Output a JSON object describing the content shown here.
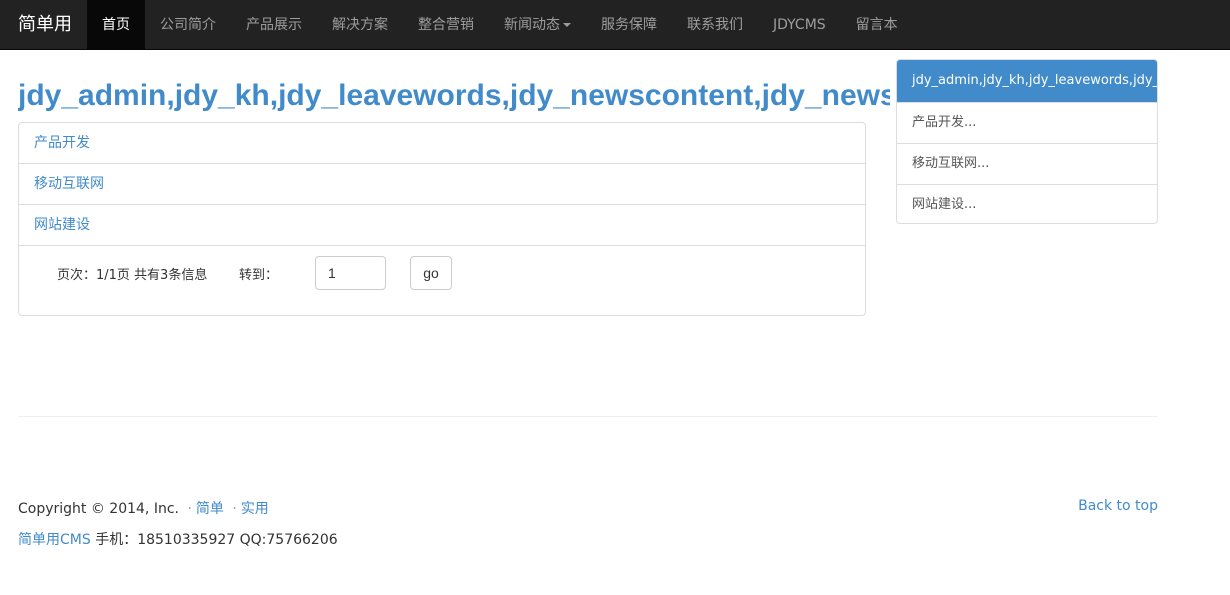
{
  "navbar": {
    "brand": "简单用",
    "items": [
      {
        "label": "首页",
        "active": true
      },
      {
        "label": "公司简介"
      },
      {
        "label": "产品展示"
      },
      {
        "label": "解决方案"
      },
      {
        "label": "整合营销"
      },
      {
        "label": "新闻动态",
        "dropdown": true
      },
      {
        "label": "服务保障"
      },
      {
        "label": "联系我们"
      },
      {
        "label": "JDYCMS"
      },
      {
        "label": "留言本"
      }
    ]
  },
  "main": {
    "heading": "jdy_admin,jdy_kh,jdy_leavewords,jdy_newscontent,jdy_newstype,jdy_pro",
    "list": [
      {
        "label": "产品开发"
      },
      {
        "label": "移动互联网"
      },
      {
        "label": "网站建设"
      }
    ],
    "pager": {
      "info": "页次：1/1页 共有3条信息",
      "goto_label": "转到：",
      "page_value": "1",
      "go_label": "go"
    }
  },
  "sidebar": {
    "active": "jdy_admin,jdy_kh,jdy_leavewords,jdy_newscontent",
    "items": [
      {
        "label": "产品开发..."
      },
      {
        "label": "移动互联网..."
      },
      {
        "label": "网站建设..."
      }
    ]
  },
  "footer": {
    "copyright": "Copyright © 2014, Inc.",
    "link1": "简单",
    "link2": "实用",
    "sep": "·",
    "cms_link": "简单用CMS",
    "contact": "手机：18510335927 QQ:75766206",
    "back_to_top": "Back to top"
  },
  "colors": {
    "navbar_bg": "#222222",
    "accent": "#428bca",
    "nav_text": "#9d9d9d"
  }
}
